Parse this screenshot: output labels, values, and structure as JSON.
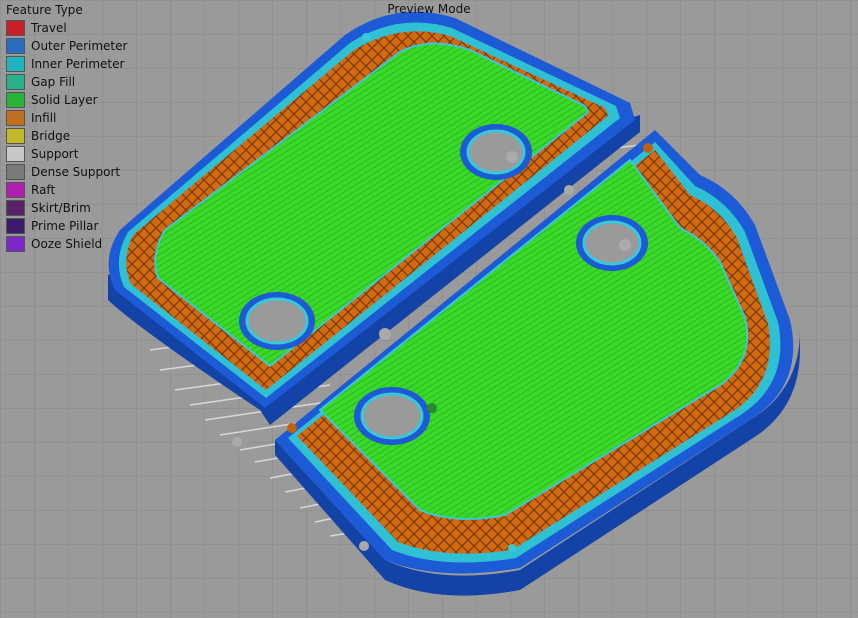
{
  "preview": {
    "mode_title": "Preview Mode"
  },
  "legend": {
    "title": "Feature Type",
    "items": [
      {
        "label": "Travel",
        "color": "#c8202a"
      },
      {
        "label": "Outer Perimeter",
        "color": "#2a6cc0"
      },
      {
        "label": "Inner Perimeter",
        "color": "#20b4c0"
      },
      {
        "label": "Gap Fill",
        "color": "#28b08a"
      },
      {
        "label": "Solid Layer",
        "color": "#28b43a"
      },
      {
        "label": "Infill",
        "color": "#c0701e"
      },
      {
        "label": "Bridge",
        "color": "#c0b828"
      },
      {
        "label": "Support",
        "color": "#c8c8c8"
      },
      {
        "label": "Dense Support",
        "color": "#7a7a7a"
      },
      {
        "label": "Raft",
        "color": "#b020b0"
      },
      {
        "label": "Skirt/Brim",
        "color": "#5a2068"
      },
      {
        "label": "Prime Pillar",
        "color": "#3a1a6a"
      },
      {
        "label": "Ooze Shield",
        "color": "#7a28c8"
      }
    ]
  },
  "colors": {
    "background": "#9a9a9a",
    "grid": "#8a8a8a",
    "outer_perimeter": "#1c5ad6",
    "inner_perimeter": "#38c8d8",
    "infill": "#d66a10",
    "solid_layer": "#34e024",
    "support": "#d8d8d8"
  }
}
